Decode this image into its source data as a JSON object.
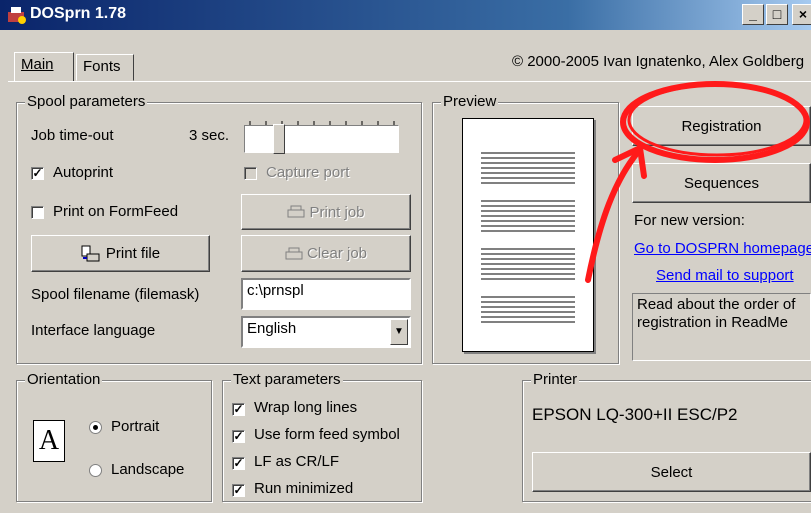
{
  "window": {
    "title": "DOSprn 1.78",
    "copyright": "© 2000-2005 Ivan Ignatenko, Alex Goldberg",
    "minimize": "_",
    "maximize": "□",
    "close": "×"
  },
  "tabs": [
    {
      "label": "Main",
      "active": true
    },
    {
      "label": "Fonts",
      "active": false
    }
  ],
  "spool": {
    "legend": "Spool parameters",
    "job_timeout_label": "Job time-out",
    "job_timeout_value": "3 sec.",
    "slider_level": 0.2,
    "autoprint_label": "Autoprint",
    "autoprint_checked": true,
    "print_on_formfeed_label": "Print on FormFeed",
    "print_on_formfeed_checked": false,
    "capture_port_label": "Capture port",
    "print_job_label": "Print job",
    "print_file_label": "Print file",
    "clear_job_label": "Clear job",
    "spool_filename_label": "Spool filename (filemask)",
    "spool_filename_value": "c:\\prnspl",
    "interface_language_label": "Interface language",
    "interface_language_value": "English"
  },
  "preview": {
    "legend": "Preview"
  },
  "right_panel": {
    "registration_label": "Registration",
    "sequences_label": "Sequences",
    "new_version_label": "For new version:",
    "homepage_link": "Go to DOSPRN homepage",
    "support_link": "Send mail to support",
    "readme_note": "Read about the order of registration in ReadMe"
  },
  "orientation": {
    "legend": "Orientation",
    "icon_letter": "A",
    "portrait_label": "Portrait",
    "landscape_label": "Landscape",
    "selected": "portrait"
  },
  "text_params": {
    "legend": "Text parameters",
    "options": [
      {
        "label": "Wrap long lines",
        "checked": true
      },
      {
        "label": "Use form feed symbol",
        "checked": true
      },
      {
        "label": "LF as CR/LF",
        "checked": true
      },
      {
        "label": "Run minimized",
        "checked": true
      }
    ]
  },
  "printer": {
    "legend": "Printer",
    "name": "EPSON LQ-300+II ESC/P2",
    "select_label": "Select"
  },
  "colors": {
    "annotation_red": "#ff1a1a",
    "title_gradient_start": "#0a246a"
  }
}
